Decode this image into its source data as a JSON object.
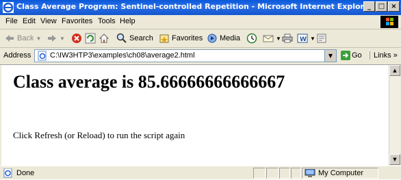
{
  "window": {
    "title": "Class Average Program: Sentinel-controlled Repetition - Microsoft Internet Explorer",
    "buttons": {
      "minimize": "_",
      "maximize": "□",
      "close": "×"
    }
  },
  "menu": [
    "File",
    "Edit",
    "View",
    "Favorites",
    "Tools",
    "Help"
  ],
  "toolbar": {
    "back": "Back",
    "search": "Search",
    "favorites": "Favorites",
    "media": "Media"
  },
  "address": {
    "label": "Address",
    "url": "C:\\IW3HTP3\\examples\\ch08\\average2.html",
    "go": "Go",
    "links": "Links »"
  },
  "page": {
    "heading": "Class average is 85.66666666666667",
    "message": "Click Refresh (or Reload) to run the script again"
  },
  "status": {
    "text": "Done",
    "zone": "My Computer"
  },
  "colors": {
    "titlebar": "#0a58d8",
    "chrome": "#ece9d8"
  }
}
